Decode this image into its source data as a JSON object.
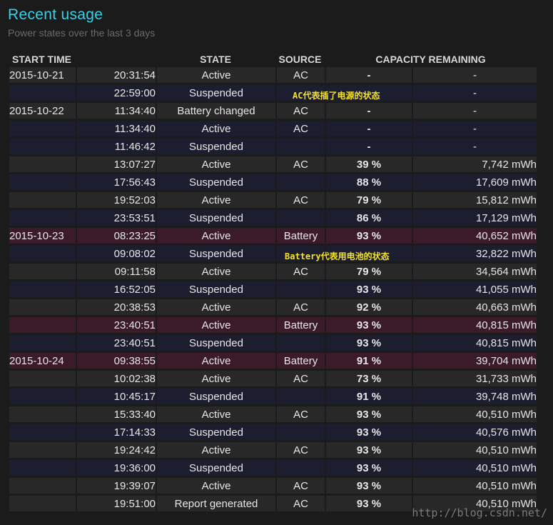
{
  "header": {
    "title": "Recent usage",
    "subtitle": "Power states over the last 3 days"
  },
  "table": {
    "columns": [
      "START TIME",
      "STATE",
      "SOURCE",
      "CAPACITY REMAINING"
    ],
    "rows": [
      {
        "date": "2015-10-21",
        "time": "20:31:54",
        "state": "Active",
        "source": "AC",
        "pct": "-",
        "cap": "-",
        "tone": "a"
      },
      {
        "date": "",
        "time": "22:59:00",
        "state": "Suspended",
        "source": "",
        "pct": "",
        "cap": "-",
        "tone": "b"
      },
      {
        "date": "2015-10-22",
        "time": "11:34:40",
        "state": "Battery changed",
        "source": "AC",
        "pct": "-",
        "cap": "-",
        "tone": "a"
      },
      {
        "date": "",
        "time": "11:34:40",
        "state": "Active",
        "source": "AC",
        "pct": "-",
        "cap": "-",
        "tone": "b"
      },
      {
        "date": "",
        "time": "11:46:42",
        "state": "Suspended",
        "source": "",
        "pct": "-",
        "cap": "-",
        "tone": "b"
      },
      {
        "date": "",
        "time": "13:07:27",
        "state": "Active",
        "source": "AC",
        "pct": "39 %",
        "cap": "7,742 mWh",
        "tone": "a"
      },
      {
        "date": "",
        "time": "17:56:43",
        "state": "Suspended",
        "source": "",
        "pct": "88 %",
        "cap": "17,609 mWh",
        "tone": "b"
      },
      {
        "date": "",
        "time": "19:52:03",
        "state": "Active",
        "source": "AC",
        "pct": "79 %",
        "cap": "15,812 mWh",
        "tone": "a"
      },
      {
        "date": "",
        "time": "23:53:51",
        "state": "Suspended",
        "source": "",
        "pct": "86 %",
        "cap": "17,129 mWh",
        "tone": "b"
      },
      {
        "date": "2015-10-23",
        "time": "08:23:25",
        "state": "Active",
        "source": "Battery",
        "pct": "93 %",
        "cap": "40,652 mWh",
        "tone": "bat"
      },
      {
        "date": "",
        "time": "09:08:02",
        "state": "Suspended",
        "source": "",
        "pct": "",
        "cap": "32,822 mWh",
        "tone": "b"
      },
      {
        "date": "",
        "time": "09:11:58",
        "state": "Active",
        "source": "AC",
        "pct": "79 %",
        "cap": "34,564 mWh",
        "tone": "a"
      },
      {
        "date": "",
        "time": "16:52:05",
        "state": "Suspended",
        "source": "",
        "pct": "93 %",
        "cap": "41,055 mWh",
        "tone": "b"
      },
      {
        "date": "",
        "time": "20:38:53",
        "state": "Active",
        "source": "AC",
        "pct": "92 %",
        "cap": "40,663 mWh",
        "tone": "a"
      },
      {
        "date": "",
        "time": "23:40:51",
        "state": "Active",
        "source": "Battery",
        "pct": "93 %",
        "cap": "40,815 mWh",
        "tone": "bat"
      },
      {
        "date": "",
        "time": "23:40:51",
        "state": "Suspended",
        "source": "",
        "pct": "93 %",
        "cap": "40,815 mWh",
        "tone": "b"
      },
      {
        "date": "2015-10-24",
        "time": "09:38:55",
        "state": "Active",
        "source": "Battery",
        "pct": "91 %",
        "cap": "39,704 mWh",
        "tone": "bat"
      },
      {
        "date": "",
        "time": "10:02:38",
        "state": "Active",
        "source": "AC",
        "pct": "73 %",
        "cap": "31,733 mWh",
        "tone": "a"
      },
      {
        "date": "",
        "time": "10:45:17",
        "state": "Suspended",
        "source": "",
        "pct": "91 %",
        "cap": "39,748 mWh",
        "tone": "b"
      },
      {
        "date": "",
        "time": "15:33:40",
        "state": "Active",
        "source": "AC",
        "pct": "93 %",
        "cap": "40,510 mWh",
        "tone": "a"
      },
      {
        "date": "",
        "time": "17:14:33",
        "state": "Suspended",
        "source": "",
        "pct": "93 %",
        "cap": "40,576 mWh",
        "tone": "b"
      },
      {
        "date": "",
        "time": "19:24:42",
        "state": "Active",
        "source": "AC",
        "pct": "93 %",
        "cap": "40,510 mWh",
        "tone": "a"
      },
      {
        "date": "",
        "time": "19:36:00",
        "state": "Suspended",
        "source": "",
        "pct": "93 %",
        "cap": "40,510 mWh",
        "tone": "b"
      },
      {
        "date": "",
        "time": "19:39:07",
        "state": "Active",
        "source": "AC",
        "pct": "93 %",
        "cap": "40,510 mWh",
        "tone": "a"
      },
      {
        "date": "",
        "time": "19:51:00",
        "state": "Report generated",
        "source": "AC",
        "pct": "93 %",
        "cap": "40,510 mWh",
        "tone": "a"
      }
    ]
  },
  "annotations": {
    "ac_note": "AC代表插了电源的状态",
    "battery_note": "Battery代表用电池的状态"
  },
  "watermark": "http://blog.csdn.net/",
  "colors": {
    "title": "#3ad0e6",
    "annotation": "#f2e22c",
    "row_dark": "#282828",
    "row_blue": "#1d1d30",
    "row_battery": "#3b1a29"
  }
}
